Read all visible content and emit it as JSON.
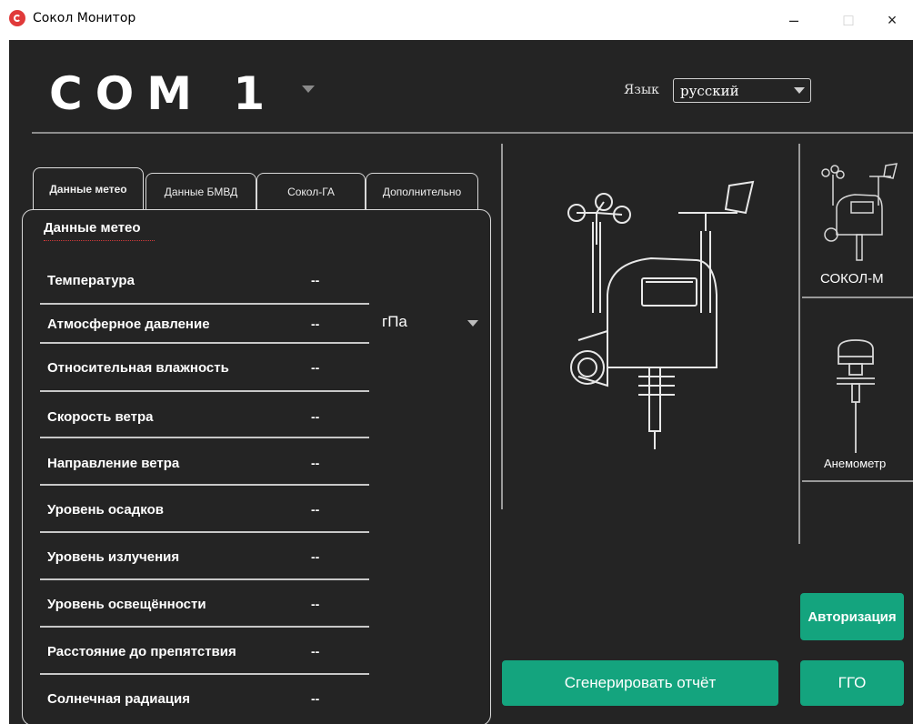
{
  "window": {
    "title": "Сокол Монитор",
    "minimize": "–",
    "maximize": "□",
    "close": "×"
  },
  "header": {
    "port": "COM 1",
    "language_label": "Язык",
    "language_value": "русский"
  },
  "tabs": [
    {
      "label": "Данные метео",
      "active": true
    },
    {
      "label": "Данные БМВД",
      "active": false
    },
    {
      "label": "Сокол-ГА",
      "active": false
    },
    {
      "label": "Дополнительно",
      "active": false
    }
  ],
  "panel": {
    "heading": "Данные метео",
    "rows": [
      {
        "label": "Температура",
        "value": "--"
      },
      {
        "label": "Атмосферное давление",
        "value": "--"
      },
      {
        "label": "Относительная влажность",
        "value": "--"
      },
      {
        "label": "Скорость ветра",
        "value": "--"
      },
      {
        "label": "Направление ветра",
        "value": "--"
      },
      {
        "label": "Уровень осадков",
        "value": "--"
      },
      {
        "label": "Уровень излучения",
        "value": "--"
      },
      {
        "label": "Уровень освещённости",
        "value": "--"
      },
      {
        "label": "Расстояние до препятствия",
        "value": "--"
      },
      {
        "label": "Солнечная радиация",
        "value": "--"
      }
    ],
    "pressure_unit": "гПа"
  },
  "devices": [
    {
      "label": "СОКОЛ-М"
    },
    {
      "label": "Анемометр"
    }
  ],
  "buttons": {
    "report": "Сгенерировать отчёт",
    "auth": "Авторизация",
    "ggo": "ГГО"
  },
  "colors": {
    "background": "#242424",
    "accent": "#14a47e",
    "logo": "#e03a3a"
  }
}
